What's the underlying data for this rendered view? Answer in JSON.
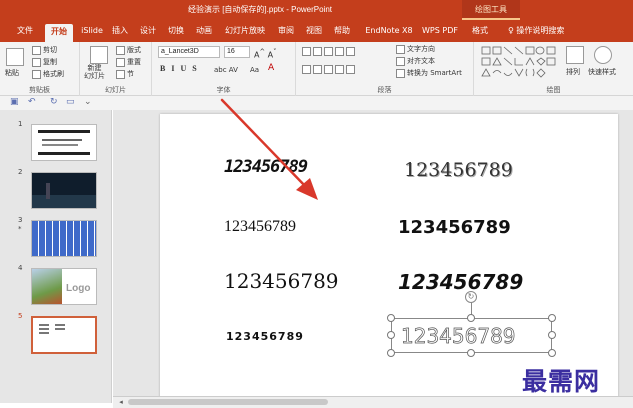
{
  "window": {
    "title": "经验演示 [自动保存的].pptx - PowerPoint",
    "context_tab": "绘图工具"
  },
  "tabs": [
    {
      "label": "文件",
      "active": false
    },
    {
      "label": "开始",
      "active": true
    },
    {
      "label": "iSlide",
      "active": false
    },
    {
      "label": "插入",
      "active": false
    },
    {
      "label": "设计",
      "active": false
    },
    {
      "label": "切换",
      "active": false
    },
    {
      "label": "动画",
      "active": false
    },
    {
      "label": "幻灯片放映",
      "active": false
    },
    {
      "label": "审阅",
      "active": false
    },
    {
      "label": "视图",
      "active": false
    },
    {
      "label": "帮助",
      "active": false
    },
    {
      "label": "EndNote X8",
      "active": false
    },
    {
      "label": "WPS PDF",
      "active": false
    },
    {
      "label": "格式",
      "active": false
    }
  ],
  "tell_me": "操作说明搜索",
  "ribbon": {
    "clipboard": {
      "paste": "粘贴",
      "cut": "剪切",
      "copy": "复制",
      "format_painter": "格式刷",
      "label": "剪贴板"
    },
    "slides": {
      "new_slide": "新建\n幻灯片",
      "layout": "版式",
      "reset": "重置",
      "section": "节",
      "label": "幻灯片"
    },
    "font": {
      "name": "a_Lancet3D",
      "size": "16",
      "label": "字体"
    },
    "paragraph": {
      "text_direction": "文字方向",
      "align_text": "对齐文本",
      "smartart": "转换为 SmartArt",
      "label": "段落"
    },
    "drawing": {
      "arrange": "排列",
      "quick_styles": "快速样式",
      "label": "绘图"
    }
  },
  "slides": [
    {
      "number": "1"
    },
    {
      "number": "2"
    },
    {
      "number": "3",
      "marker": "*"
    },
    {
      "number": "4",
      "thumb_text": "Logo"
    },
    {
      "number": "5"
    }
  ],
  "slide_text": {
    "items": [
      "123456789",
      "123456789",
      "123456789",
      "123456789",
      "123456789",
      "123456789",
      "123456789",
      "123456789"
    ]
  },
  "watermark": "最需网",
  "colors": {
    "accent": "#c43e1c",
    "arrow": "#d9382b",
    "selection": "#d0603a"
  }
}
